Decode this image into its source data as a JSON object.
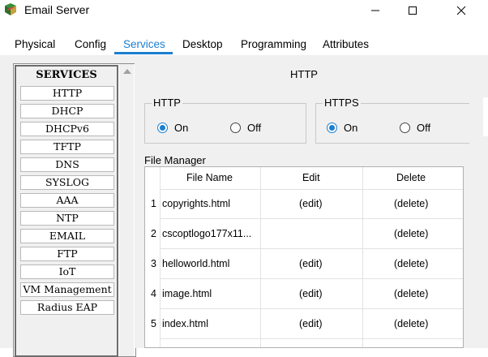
{
  "window": {
    "title": "Email Server"
  },
  "tabs": [
    {
      "label": "Physical"
    },
    {
      "label": "Config"
    },
    {
      "label": "Services",
      "active": true
    },
    {
      "label": "Desktop"
    },
    {
      "label": "Programming"
    },
    {
      "label": "Attributes"
    }
  ],
  "services": {
    "header": "SERVICES",
    "items": [
      "HTTP",
      "DHCP",
      "DHCPv6",
      "TFTP",
      "DNS",
      "SYSLOG",
      "AAA",
      "NTP",
      "EMAIL",
      "FTP",
      "IoT",
      "VM Management",
      "Radius EAP"
    ]
  },
  "http_panel": {
    "title": "HTTP",
    "http": {
      "label": "HTTP",
      "on": "On",
      "off": "Off",
      "selected": "On"
    },
    "https": {
      "label": "HTTPS",
      "on": "On",
      "off": "Off",
      "selected": "On"
    }
  },
  "file_manager": {
    "label": "File Manager",
    "columns": [
      "File Name",
      "Edit",
      "Delete"
    ],
    "rows": [
      {
        "num": "1",
        "name": "copyrights.html",
        "edit": "(edit)",
        "delete": "(delete)"
      },
      {
        "num": "2",
        "name": "cscoptlogo177x11...",
        "edit": "",
        "delete": "(delete)"
      },
      {
        "num": "3",
        "name": "helloworld.html",
        "edit": "(edit)",
        "delete": "(delete)"
      },
      {
        "num": "4",
        "name": "image.html",
        "edit": "(edit)",
        "delete": "(delete)"
      },
      {
        "num": "5",
        "name": "index.html",
        "edit": "(edit)",
        "delete": "(delete)"
      }
    ]
  },
  "colors": {
    "accent": "#1a7fd0",
    "panel": "#f0f0f0"
  },
  "icons": [
    "app-icon",
    "minimize-icon",
    "maximize-icon",
    "close-icon",
    "scroll-up-arrow-icon"
  ]
}
